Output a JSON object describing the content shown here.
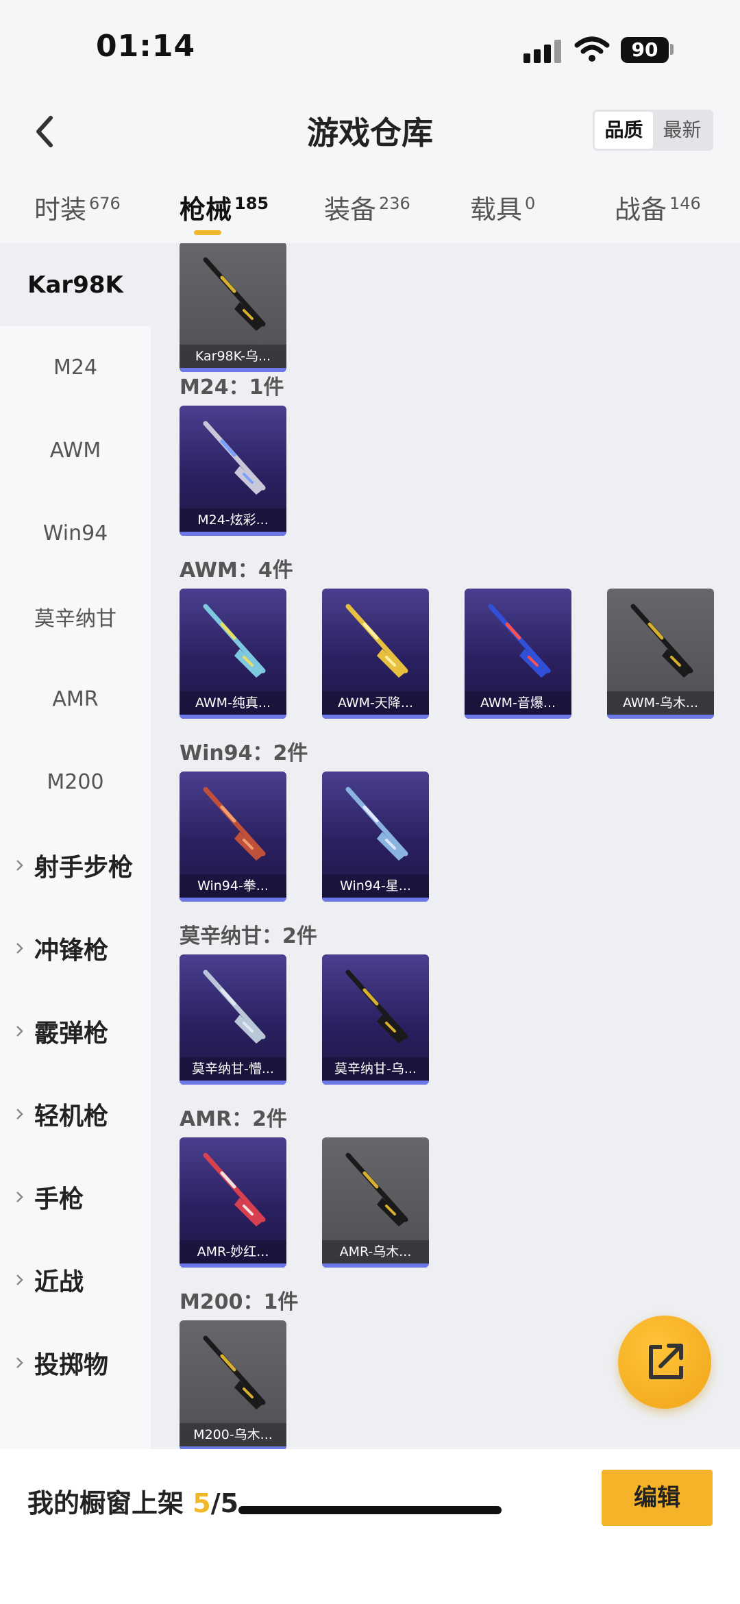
{
  "status": {
    "time": "01:14",
    "battery": "90"
  },
  "header": {
    "title": "游戏仓库",
    "sort_quality": "品质",
    "sort_newest": "最新"
  },
  "tabs": [
    {
      "label": "时装",
      "count": "676"
    },
    {
      "label": "枪械",
      "count": "185"
    },
    {
      "label": "装备",
      "count": "236"
    },
    {
      "label": "载具",
      "count": "0"
    },
    {
      "label": "战备",
      "count": "146"
    }
  ],
  "sidebar": {
    "items": [
      "Kar98K",
      "M24",
      "AWM",
      "Win94",
      "莫辛纳甘",
      "AMR",
      "M200"
    ],
    "groups": [
      "射手步枪",
      "冲锋枪",
      "霰弹枪",
      "轻机枪",
      "手枪",
      "近战",
      "投掷物"
    ]
  },
  "sections": [
    {
      "title": "M24：1件",
      "cards": [
        {
          "label": "M24-炫彩...",
          "style": "purple",
          "gun_color": "#c8c8d8",
          "accent": "#7aa0ff"
        }
      ]
    },
    {
      "title": "AWM：4件",
      "cards": [
        {
          "label": "AWM-纯真...",
          "style": "purple",
          "gun_color": "#7ec8e0",
          "accent": "#e8e060"
        },
        {
          "label": "AWM-天降...",
          "style": "purple",
          "gun_color": "#e8c040",
          "accent": "#fff0a0"
        },
        {
          "label": "AWM-音爆...",
          "style": "purple",
          "gun_color": "#3050d8",
          "accent": "#ff5050"
        },
        {
          "label": "AWM-乌木...",
          "style": "gray",
          "gun_color": "#1a1a1a",
          "accent": "#d8b030"
        }
      ]
    },
    {
      "title": "Win94：2件",
      "cards": [
        {
          "label": "Win94-拳...",
          "style": "purple",
          "gun_color": "#c0503a",
          "accent": "#f0a070"
        },
        {
          "label": "Win94-星...",
          "style": "purple",
          "gun_color": "#8ab4e0",
          "accent": "#e0e8ff"
        }
      ]
    },
    {
      "title": "莫辛纳甘：2件",
      "cards": [
        {
          "label": "莫辛纳甘-懵...",
          "style": "purple",
          "gun_color": "#b8c8d8",
          "accent": "#e0e8f0"
        },
        {
          "label": "莫辛纳甘-乌...",
          "style": "purple",
          "gun_color": "#1a1a1a",
          "accent": "#d8b030"
        }
      ]
    },
    {
      "title": "AMR：2件",
      "cards": [
        {
          "label": "AMR-妙红...",
          "style": "purple",
          "gun_color": "#d84050",
          "accent": "#f0e0e0"
        },
        {
          "label": "AMR-乌木...",
          "style": "gray",
          "gun_color": "#1a1a1a",
          "accent": "#d8b030"
        }
      ]
    },
    {
      "title": "M200：1件",
      "cards": [
        {
          "label": "M200-乌木...",
          "style": "gray",
          "gun_color": "#1a1a1a",
          "accent": "#d8b030"
        }
      ]
    }
  ],
  "top_card": {
    "label": "Kar98K-乌...",
    "style": "gray",
    "gun_color": "#1a1a1a",
    "accent": "#d8b030"
  },
  "bottom": {
    "shelf_label": "我的橱窗上架 ",
    "shelf_current": "5",
    "shelf_total": "/5",
    "edit_label": "编辑"
  },
  "colors": {
    "accent": "#f0b728",
    "quality_blue": "#6c78e8"
  }
}
